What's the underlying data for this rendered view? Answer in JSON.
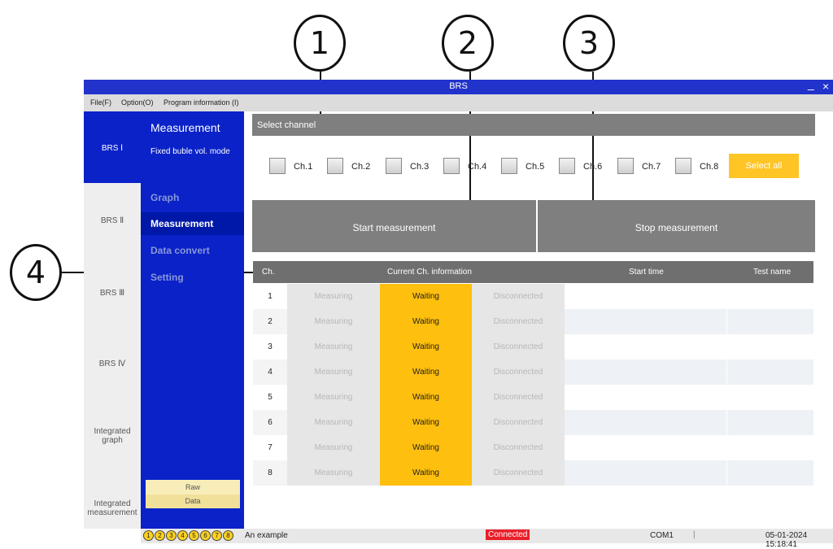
{
  "callouts": [
    "1",
    "2",
    "3",
    "4"
  ],
  "window": {
    "title": "BRS",
    "minimize": "_",
    "close": "×"
  },
  "menu": [
    "File(F)",
    "Option(O)",
    "Program information (I)"
  ],
  "sidebar_left": [
    "BRS Ⅰ",
    "BRS Ⅱ",
    "BRS Ⅲ",
    "BRS Ⅳ",
    "Integrated graph",
    "Integrated measurement"
  ],
  "panel": {
    "title": "Measurement",
    "subtitle": "Fixed buble vol. mode"
  },
  "nav": [
    "Graph",
    "Measurement",
    "Data convert",
    "Setting"
  ],
  "bottom_buttons": {
    "raw": "Raw",
    "data": "Data"
  },
  "select_channel": "Select channel",
  "channels": [
    "Ch.1",
    "Ch.2",
    "Ch.3",
    "Ch.4",
    "Ch.5",
    "Ch.6",
    "Ch.7",
    "Ch.8"
  ],
  "select_all": "Select all",
  "buttons": {
    "start": "Start measurement",
    "stop": "Stop measurement"
  },
  "table": {
    "headers": {
      "ch": "Ch.",
      "info": "Current Ch. information",
      "start": "Start time",
      "test": "Test name"
    },
    "rows": [
      {
        "ch": "1",
        "measuring": "Measuring",
        "waiting": "Waiting",
        "disconnected": "Disconnected",
        "start": "",
        "test": ""
      },
      {
        "ch": "2",
        "measuring": "Measuring",
        "waiting": "Waiting",
        "disconnected": "Disconnected",
        "start": "",
        "test": ""
      },
      {
        "ch": "3",
        "measuring": "Measuring",
        "waiting": "Waiting",
        "disconnected": "Disconnected",
        "start": "",
        "test": ""
      },
      {
        "ch": "4",
        "measuring": "Measuring",
        "waiting": "Waiting",
        "disconnected": "Disconnected",
        "start": "",
        "test": ""
      },
      {
        "ch": "5",
        "measuring": "Measuring",
        "waiting": "Waiting",
        "disconnected": "Disconnected",
        "start": "",
        "test": ""
      },
      {
        "ch": "6",
        "measuring": "Measuring",
        "waiting": "Waiting",
        "disconnected": "Disconnected",
        "start": "",
        "test": ""
      },
      {
        "ch": "7",
        "measuring": "Measuring",
        "waiting": "Waiting",
        "disconnected": "Disconnected",
        "start": "",
        "test": ""
      },
      {
        "ch": "8",
        "measuring": "Measuring",
        "waiting": "Waiting",
        "disconnected": "Disconnected",
        "start": "",
        "test": ""
      }
    ]
  },
  "status": {
    "indicators": [
      "1",
      "2",
      "3",
      "4",
      "5",
      "6",
      "7",
      "8"
    ],
    "text": "An example",
    "connection": "Connected",
    "port": "COM1",
    "separator": "|",
    "datetime": "05-01-2024 15:18:41"
  },
  "colors": {
    "accent_blue": "#0a22c8",
    "yellow": "#ffc525",
    "gray_bar": "#7f7f7f",
    "connected_red": "#e8202a"
  }
}
